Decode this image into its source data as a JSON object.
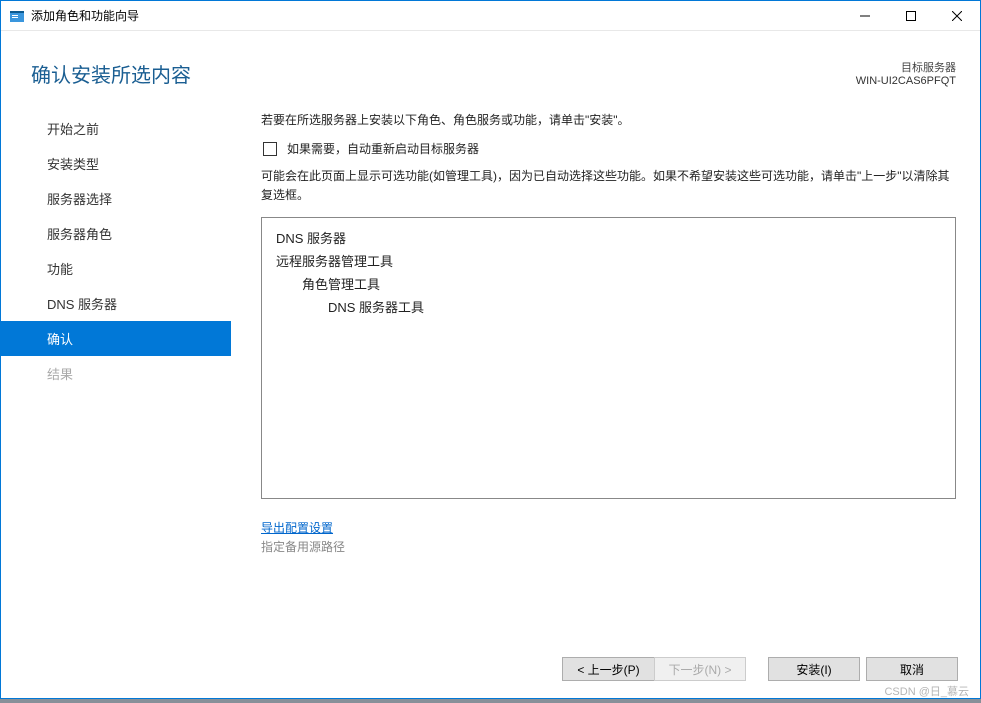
{
  "window": {
    "title": "添加角色和功能向导"
  },
  "header": {
    "title": "确认安装所选内容",
    "target_label": "目标服务器",
    "target_name": "WIN-UI2CAS6PFQT"
  },
  "sidebar": {
    "items": [
      {
        "label": "开始之前",
        "state": "normal"
      },
      {
        "label": "安装类型",
        "state": "normal"
      },
      {
        "label": "服务器选择",
        "state": "normal"
      },
      {
        "label": "服务器角色",
        "state": "normal"
      },
      {
        "label": "功能",
        "state": "normal"
      },
      {
        "label": "DNS 服务器",
        "state": "normal"
      },
      {
        "label": "确认",
        "state": "selected"
      },
      {
        "label": "结果",
        "state": "disabled"
      }
    ]
  },
  "content": {
    "intro": "若要在所选服务器上安装以下角色、角色服务或功能，请单击\"安装\"。",
    "checkbox_label": "如果需要，自动重新启动目标服务器",
    "note": "可能会在此页面上显示可选功能(如管理工具)，因为已自动选择这些功能。如果不希望安装这些可选功能，请单击\"上一步\"以清除其复选框。",
    "features": [
      {
        "label": "DNS 服务器",
        "indent": 0
      },
      {
        "label": "远程服务器管理工具",
        "indent": 0
      },
      {
        "label": "角色管理工具",
        "indent": 1
      },
      {
        "label": "DNS 服务器工具",
        "indent": 2
      }
    ],
    "export_link": "导出配置设置",
    "alt_source": "指定备用源路径"
  },
  "footer": {
    "prev": "< 上一步(P)",
    "next": "下一步(N) >",
    "install": "安装(I)",
    "cancel": "取消"
  },
  "watermark": "CSDN @日_慕云"
}
